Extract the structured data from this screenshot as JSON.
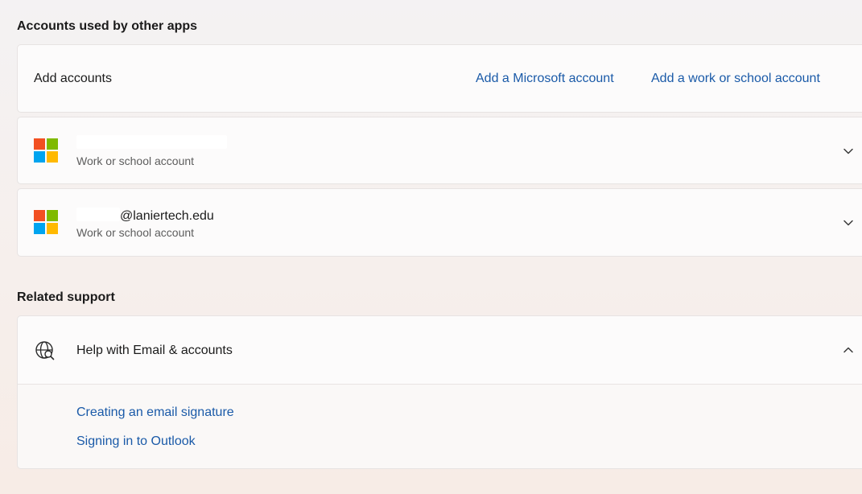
{
  "sections": {
    "accounts_title": "Accounts used by other apps",
    "support_title": "Related support"
  },
  "add_accounts": {
    "label": "Add accounts",
    "microsoft_link": "Add a Microsoft account",
    "work_school_link": "Add a work or school account"
  },
  "accounts": [
    {
      "email": "",
      "type": "Work or school account",
      "icon": "microsoft-logo-icon"
    },
    {
      "email": "@laniertech.edu",
      "type": "Work or school account",
      "icon": "microsoft-logo-icon"
    }
  ],
  "help": {
    "title": "Help with Email & accounts",
    "icon": "globe-search-icon",
    "expanded": true,
    "links": [
      "Creating an email signature",
      "Signing in to Outlook"
    ]
  },
  "colors": {
    "link": "#1a5aa8",
    "ms_red": "#f25022",
    "ms_green": "#7fba00",
    "ms_blue": "#00a4ef",
    "ms_yellow": "#ffb900"
  }
}
